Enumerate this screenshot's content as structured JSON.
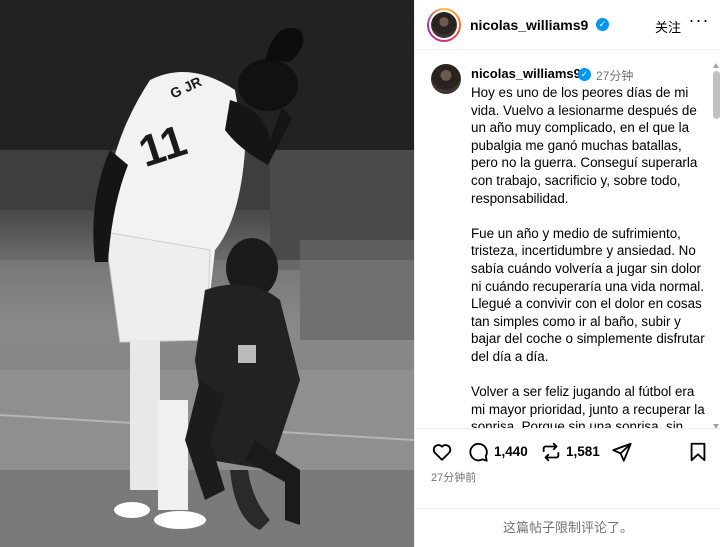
{
  "post": {
    "username": "nicolas_williams9",
    "follow_label": "关注",
    "more_label": "···",
    "caption_username": "nicolas_williams9",
    "caption_time": "27分钟",
    "caption_paragraphs": [
      "Hoy es uno de los peores días de mi vida. Vuelvo a lesionarme después de un año muy complicado, en el que la pubalgia me ganó muchas batallas, pero no la guerra. Conseguí superarla con trabajo, sacrificio y, sobre todo, responsabilidad.",
      "Fue un año y medio de sufrimiento, tristeza, incertidumbre y ansiedad. No sabía cuándo volvería a jugar sin dolor ni cuándo recuperaría una vida normal. Llegué a convivir con el dolor en cosas tan simples como ir al baño, subir y bajar del coche o simplemente disfrutar del día a día.",
      "Volver a ser feliz jugando al fútbol era mi mayor prioridad, junto a recuperar la sonrisa. Porque sin una sonrisa, sin disfrutar y sin ser feliz, no"
    ],
    "likes": "1,440",
    "reposts": "1,581",
    "time_ago": "27分钟前",
    "comments_disabled": "这篇帖子限制评论了。"
  },
  "photo": {
    "jersey_name": "G JR",
    "jersey_number": "11"
  },
  "icons": [
    "verified-icon",
    "more-icon",
    "heart-icon",
    "comment-icon",
    "repost-icon",
    "share-icon",
    "bookmark-icon"
  ],
  "colors": {
    "verified": "#0095f6",
    "muted": "#737373",
    "border": "#efefef"
  }
}
